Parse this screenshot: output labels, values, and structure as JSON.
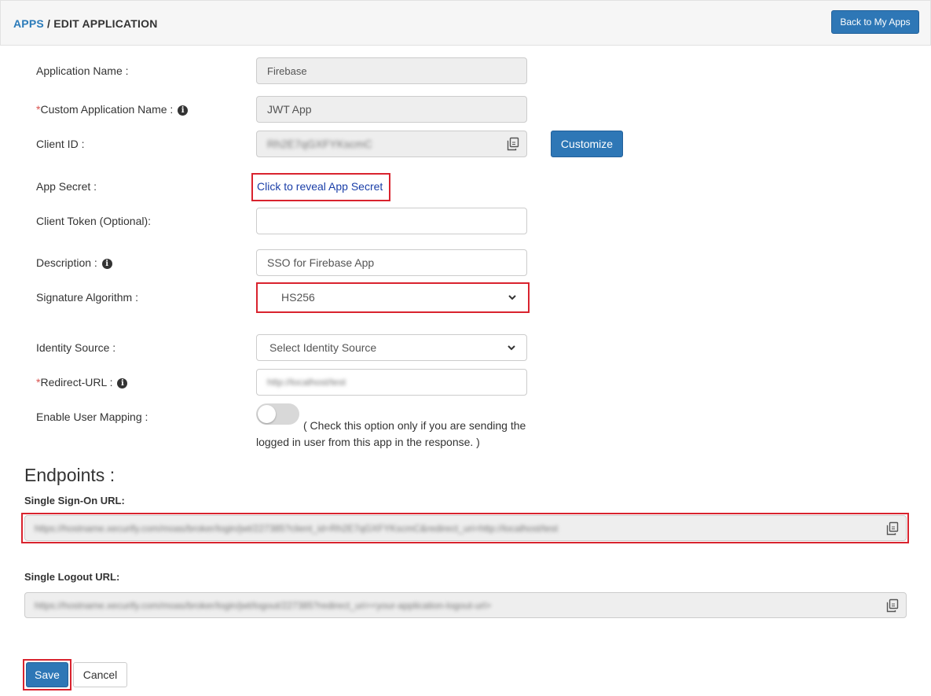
{
  "breadcrumb": {
    "root": "APPS",
    "separator": " / ",
    "current": "EDIT APPLICATION"
  },
  "header": {
    "back_button": "Back to My Apps"
  },
  "form": {
    "application_name": {
      "label": "Application Name :",
      "value": "Firebase"
    },
    "custom_application_name": {
      "required_mark": "*",
      "label": "Custom Application Name :",
      "value": "JWT App",
      "icon": "info-icon"
    },
    "client_id": {
      "label": "Client ID :",
      "value": "Rh2E7qGXFYKscmC",
      "icon": "copy-icon",
      "customize_button": "Customize"
    },
    "app_secret": {
      "label": "App Secret :",
      "link": "Click to reveal App Secret"
    },
    "client_token": {
      "label": "Client Token (Optional):",
      "value": ""
    },
    "description": {
      "label": "Description :",
      "value": "SSO for Firebase App",
      "icon": "info-icon"
    },
    "signature_algorithm": {
      "label": "Signature Algorithm :",
      "value": "HS256"
    },
    "identity_source": {
      "label": "Identity Source :",
      "value": "Select Identity Source"
    },
    "redirect_url": {
      "required_mark": "*",
      "label": "Redirect-URL :",
      "value": "http://localhost/test",
      "icon": "info-icon"
    },
    "user_mapping": {
      "label": "Enable User Mapping :",
      "enabled": false,
      "note": "( Check this option only if you are sending the logged in user from this app in the response. )"
    }
  },
  "endpoints": {
    "title": "Endpoints :",
    "sso_url": {
      "label": "Single Sign-On URL:",
      "value": "https://hostname.xecurify.com/moas/broker/login/jwt/227385?client_id=Rh2E7qGXFYKscmC&redirect_uri=http://localhost/test"
    },
    "logout_url": {
      "label": "Single Logout URL:",
      "value": "https://hostname.xecurify.com/moas/broker/login/jwt/logout/227385?redirect_uri=<your-application-logout-url>"
    }
  },
  "actions": {
    "save": "Save",
    "cancel": "Cancel"
  },
  "colors": {
    "primary": "#2e77b6",
    "highlight": "#d9232e",
    "link": "#1a3ea8"
  }
}
